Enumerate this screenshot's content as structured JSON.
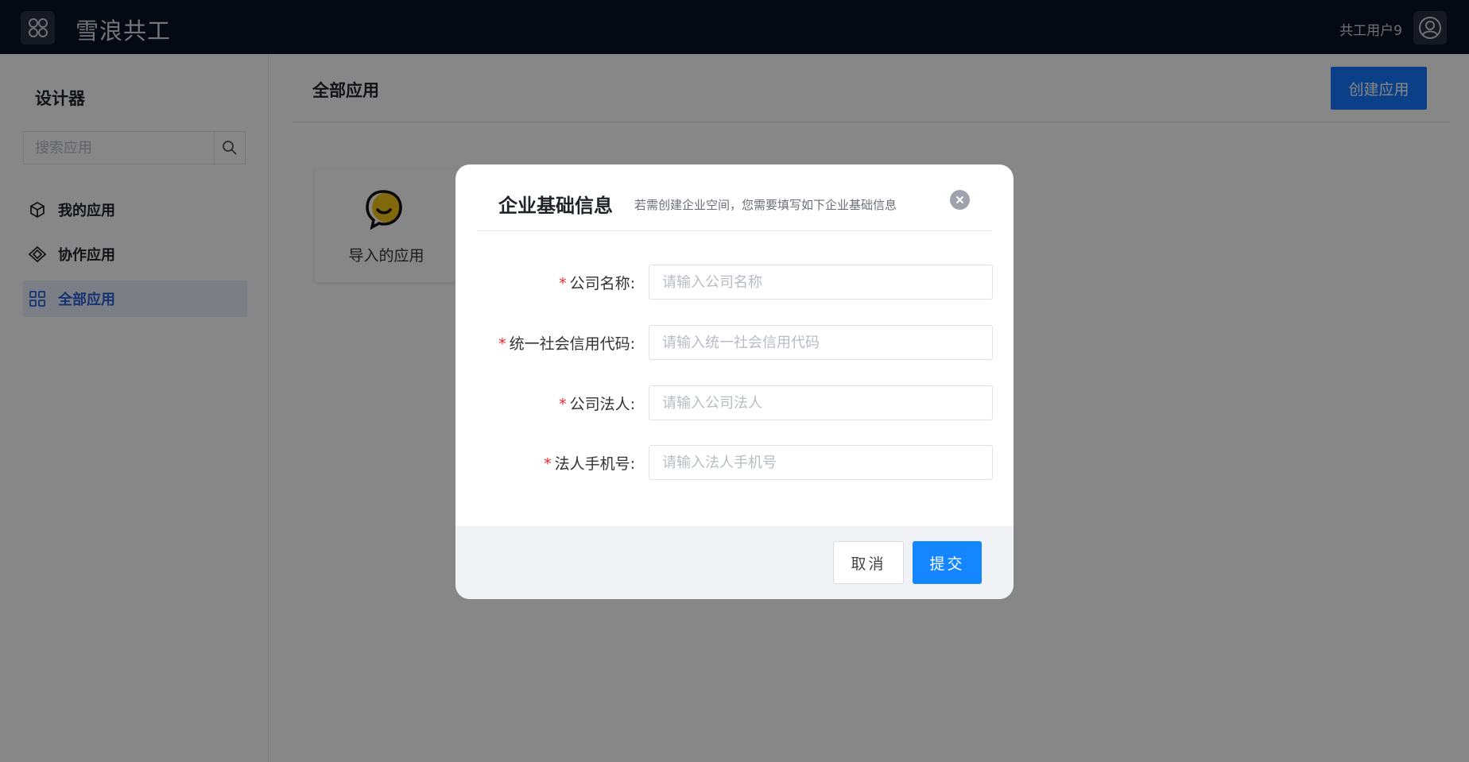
{
  "header": {
    "app_title": "雪浪共工",
    "username": "共工用户9"
  },
  "sidebar": {
    "title": "设计器",
    "search_placeholder": "搜索应用",
    "items": [
      {
        "label": "我的应用",
        "icon": "cube-icon"
      },
      {
        "label": "协作应用",
        "icon": "collab-icon"
      },
      {
        "label": "全部应用",
        "icon": "grid-icon",
        "active": true
      }
    ]
  },
  "main": {
    "title": "全部应用",
    "create_button": "创建应用",
    "apps": [
      {
        "label": "导入的应用",
        "icon": "chat-bubble-icon"
      }
    ]
  },
  "modal": {
    "title": "企业基础信息",
    "subtitle": "若需创建企业空间，您需要填写如下企业基础信息",
    "fields": [
      {
        "label": "公司名称:",
        "placeholder": "请输入公司名称",
        "required": true
      },
      {
        "label": "统一社会信用代码:",
        "placeholder": "请输入统一社会信用代码",
        "required": true
      },
      {
        "label": "公司法人:",
        "placeholder": "请输入公司法人",
        "required": true
      },
      {
        "label": "法人手机号:",
        "placeholder": "请输入法人手机号",
        "required": true
      }
    ],
    "required_mark": "*",
    "cancel_label": "取消",
    "submit_label": "提交"
  },
  "colors": {
    "topbar": "#0a1126",
    "primary": "#1677ff",
    "active_nav": "#2b5fd9",
    "required": "#f5222d"
  }
}
